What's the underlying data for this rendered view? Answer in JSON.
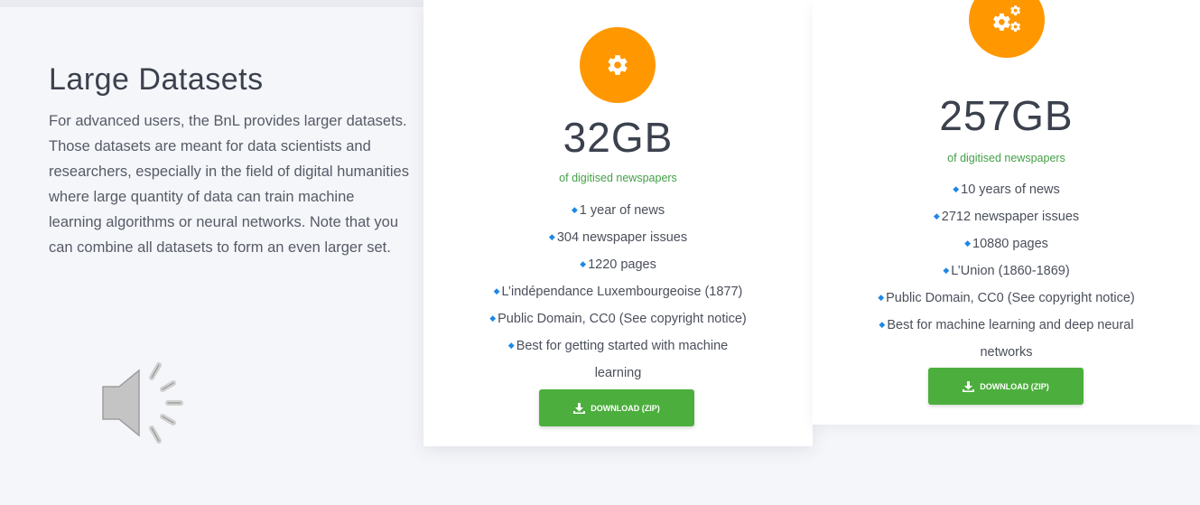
{
  "intro": {
    "title": "Large Datasets",
    "body": "For advanced users, the BnL provides larger datasets. Those datasets are meant for data scientists and researchers, especially in the field of digital humanities where large quantity of data can train machine learning algorithms or neural networks. Note that you can combine all datasets to form an even larger set."
  },
  "speaker": {
    "icon": "speaker-icon"
  },
  "cards": [
    {
      "icon": "gear-icon",
      "size": "32GB",
      "subtitle": "of digitised newspapers",
      "features": [
        "1 year of news",
        "304 newspaper issues",
        "1220 pages",
        "L’indépendance Luxembourgeoise (1877)",
        "Public Domain, CC0 (See copyright notice)",
        "Best for getting started with machine learning"
      ],
      "button": "DOWNLOAD (ZIP)"
    },
    {
      "icon": "gears-icon",
      "size": "257GB",
      "subtitle": "of digitised newspapers",
      "features": [
        "10 years of news",
        "2712 newspaper issues",
        "10880 pages",
        "L’Union (1860-1869)",
        "Public Domain, CC0 (See copyright notice)",
        "Best for machine learning and deep neural networks"
      ],
      "button": "DOWNLOAD (ZIP)"
    }
  ],
  "colors": {
    "accent": "#ff9800",
    "button": "#4caf3d",
    "subtitle": "#43a047",
    "bullet": "#1e88e5"
  }
}
